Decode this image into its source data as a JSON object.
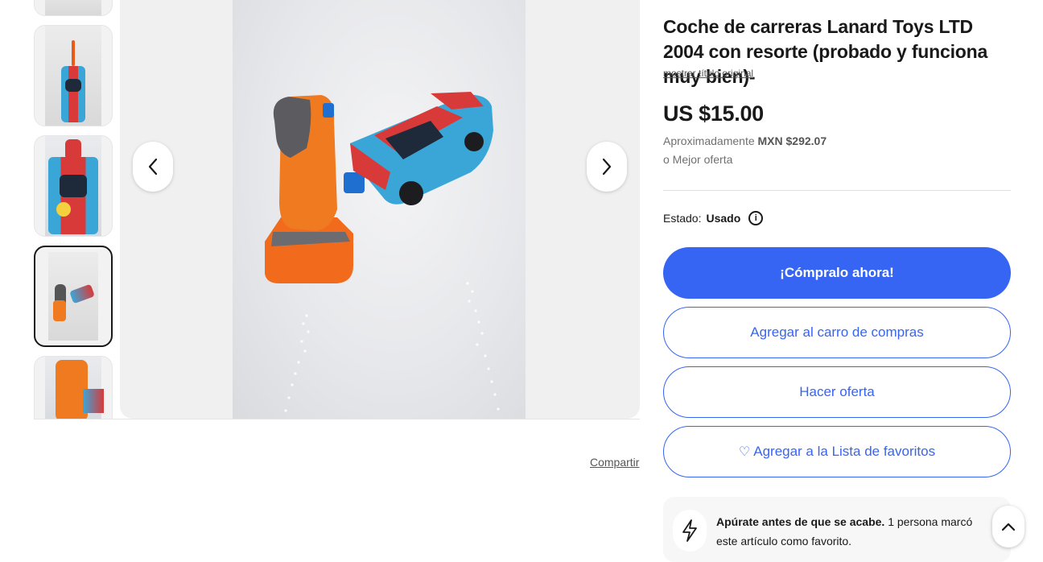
{
  "product": {
    "title": "Coche de carreras Lanard Toys LTD 2004 con resorte (probado y funciona muy bien)-",
    "show_original_title": "mostrar título original",
    "price": "US $15.00",
    "approx_label": "Aproximadamente",
    "approx_value": "MXN $292.07",
    "best_offer": "o Mejor oferta",
    "condition_label": "Estado:",
    "condition_value": "Usado"
  },
  "actions": {
    "buy_now": "¡Cómpralo ahora!",
    "add_to_cart": "Agregar al carro de compras",
    "make_offer": "Hacer oferta",
    "watchlist": "Agregar a la Lista de favoritos"
  },
  "gallery": {
    "share": "Compartir",
    "thumbnails": [
      "car-top-view",
      "car-front-view",
      "launcher-and-car",
      "launcher-closeup"
    ],
    "selected_index": 2
  },
  "urgency": {
    "bold": "Apúrate antes de que se acabe.",
    "text": "1 persona marcó este artículo como favorito."
  },
  "colors": {
    "accent": "#3665f3",
    "text": "#191919"
  },
  "icons": {
    "prev": "chevron-left-icon",
    "next": "chevron-right-icon",
    "info": "info-icon",
    "heart": "heart-icon",
    "bolt": "lightning-icon",
    "scroll_top": "chevron-up-icon"
  }
}
